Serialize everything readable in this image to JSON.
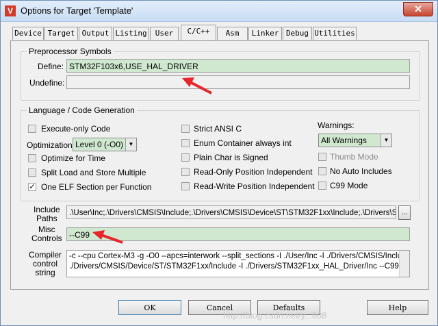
{
  "window": {
    "title": "Options for Target 'Template'",
    "icon_letter": "V",
    "close_glyph": "✕"
  },
  "tabs": [
    {
      "label": "Device"
    },
    {
      "label": "Target"
    },
    {
      "label": "Output"
    },
    {
      "label": "Listing"
    },
    {
      "label": "User"
    },
    {
      "label": "C/C++"
    },
    {
      "label": "Asm"
    },
    {
      "label": "Linker"
    },
    {
      "label": "Debug"
    },
    {
      "label": "Utilities"
    }
  ],
  "preprocessor": {
    "title": "Preprocessor Symbols",
    "define_label": "Define:",
    "define_value": "STM32F103x6,USE_HAL_DRIVER",
    "undefine_label": "Undefine:",
    "undefine_value": ""
  },
  "language": {
    "title": "Language / Code Generation",
    "execute_only": "Execute-only Code",
    "optimization_label": "Optimization:",
    "optimization_value": "Level 0 (-O0)",
    "optimize_time": "Optimize for Time",
    "split_load": "Split Load and Store Multiple",
    "one_elf": "One ELF Section per Function",
    "strict_ansi": "Strict ANSI C",
    "enum_container": "Enum Container always int",
    "plain_char": "Plain Char is Signed",
    "ro_pos": "Read-Only Position Independent",
    "rw_pos": "Read-Write Position Independent",
    "warnings_label": "Warnings:",
    "warnings_value": "All Warnings",
    "thumb_mode": "Thumb Mode",
    "no_auto_includes": "No Auto Includes",
    "c99_mode": "C99 Mode"
  },
  "include": {
    "label_line1": "Include",
    "label_line2": "Paths",
    "value": ".\\User\\Inc;.\\Drivers\\CMSIS\\Include;.\\Drivers\\CMSIS\\Device\\ST\\STM32F1xx\\Include;.\\Drivers\\ST",
    "browse": "..."
  },
  "misc": {
    "label_line1": "Misc",
    "label_line2": "Controls",
    "value": "--C99"
  },
  "compiler": {
    "label_line1": "Compiler",
    "label_line2": "control",
    "label_line3": "string",
    "line1": "-c --cpu Cortex-M3 -g -O0 --apcs=interwork --split_sections -I ./User/Inc -I ./Drivers/CMSIS/Include -I",
    "line2": "./Drivers/CMSIS/Device/ST/STM32F1xx/Include -I ./Drivers/STM32F1xx_HAL_Driver/Inc --C99"
  },
  "buttons": {
    "ok": "OK",
    "cancel": "Cancel",
    "defaults": "Defaults",
    "help": "Help"
  },
  "watermark": "http://blog.csdn.net/y...008",
  "colors": {
    "field_green": "#cfe8cf",
    "arrow_red": "#e8252b"
  }
}
